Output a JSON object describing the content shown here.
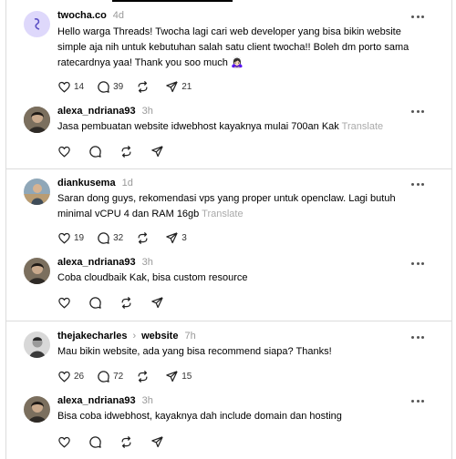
{
  "posts": [
    {
      "username": "twocha.co",
      "time": "4d",
      "text": "Hello warga Threads! Twocha lagi cari web developer yang bisa bikin website simple aja nih untuk kebutuhan salah satu client twocha!! Boleh dm porto sama ratecardnya yaa! Thank you soo much 🙇🏻‍♀️",
      "likes": "14",
      "replies": "39",
      "reposts": "",
      "shares": "21"
    },
    {
      "username": "alexa_ndriana93",
      "time": "3h",
      "text": "Jasa pembuatan website idwebhost kayaknya mulai 700an Kak",
      "translate": "Translate"
    },
    {
      "username": "diankusema",
      "time": "1d",
      "text": "Saran dong guys, rekomendasi vps yang proper untuk openclaw. Lagi butuh minimal vCPU 4 dan RAM 16gb",
      "translate": "Translate",
      "likes": "19",
      "replies": "32",
      "reposts": "",
      "shares": "3"
    },
    {
      "username": "alexa_ndriana93",
      "time": "3h",
      "text": "Coba cloudbaik Kak, bisa custom resource"
    },
    {
      "username": "thejakecharles",
      "topic": "website",
      "time": "7h",
      "text": "Mau bikin website, ada yang bisa recommend siapa? Thanks!",
      "likes": "26",
      "replies": "72",
      "reposts": "",
      "shares": "15"
    },
    {
      "username": "alexa_ndriana93",
      "time": "3h",
      "text": "Bisa coba idwebhost, kayaknya dah include domain dan hosting"
    }
  ],
  "colors": {
    "accent_lavender": "#d9d2f7",
    "text_muted": "#999999",
    "divider": "#dcdcdc"
  },
  "icons": [
    "heart-icon",
    "comment-icon",
    "repost-icon",
    "share-icon",
    "more-icon"
  ]
}
